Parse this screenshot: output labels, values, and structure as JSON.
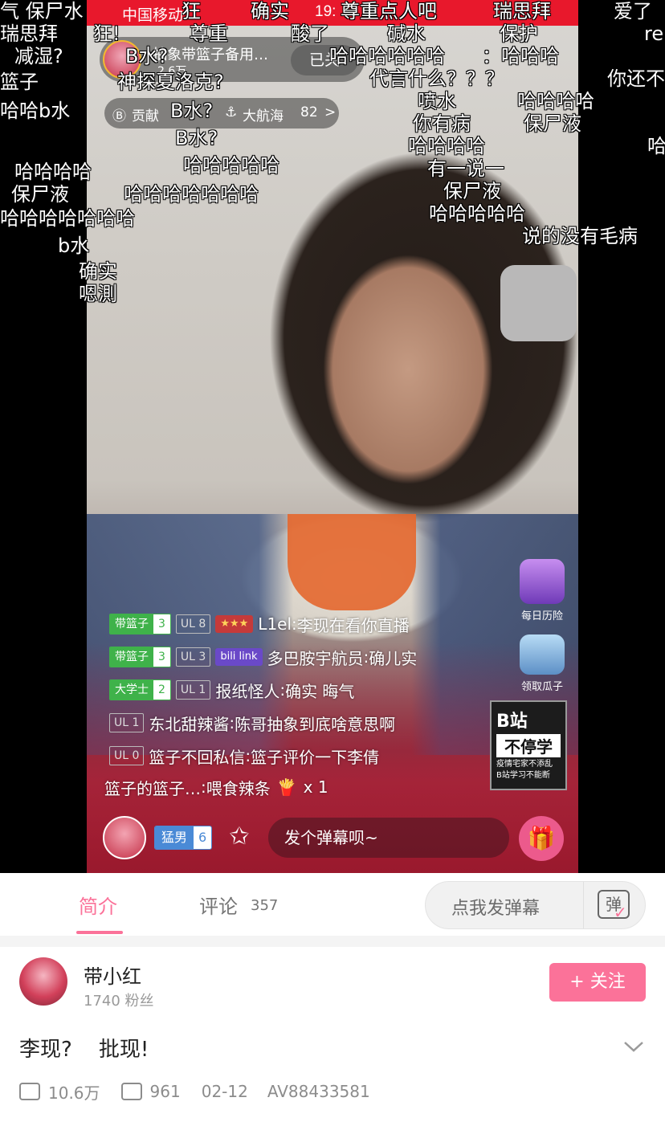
{
  "status_bar": {
    "carrier": "中国移动",
    "time": "19:"
  },
  "anchor": {
    "name": "抽象带篮子备用…",
    "popularity": "2.6万",
    "follow_label": "已关"
  },
  "rank_bar": {
    "contrib_label": "贡献",
    "fleet_label": "大航海",
    "fleet_count": "82",
    "chevron": ">"
  },
  "side": {
    "daily_adventure": "每日历险",
    "melon_seeds": "领取瓜子",
    "promo_line1": "B站",
    "promo_line2": "不停学",
    "promo_line3": "疫情宅家不添乱",
    "promo_line4": "B站学习不能断"
  },
  "chat": [
    {
      "medal_name": "带篮子",
      "medal_level": "3",
      "ul": "UL 8",
      "user": "L1el",
      "text": "李现在看你直播"
    },
    {
      "medal_name": "带篮子",
      "medal_level": "3",
      "ul": "UL 3",
      "user": "多巴胺宇航员",
      "text": "确儿实"
    },
    {
      "medal_name": "大学士",
      "medal_level": "2",
      "ul": "UL 1",
      "user": "报纸怪人",
      "text": "确实 晦气"
    },
    {
      "ul": "UL 1",
      "user": "东北甜辣酱",
      "text": "陈哥抽象到底啥意思啊"
    },
    {
      "ul": "UL 0",
      "user": "篮子不回私信",
      "text": "篮子评价一下李倩"
    },
    {
      "user": "篮子的篮子…",
      "text": "喂食辣条",
      "count": "x 1"
    }
  ],
  "live_bottom": {
    "medal_name": "猛男",
    "medal_level": "6",
    "input_placeholder": "发个弹幕呗~"
  },
  "danmaku": [
    "气 保尸水",
    "狂",
    "确实",
    "尊重点人吧",
    "瑞思拜",
    "爱了",
    "瑞思拜",
    "狂!",
    "尊重",
    "酸了",
    "碱水",
    "保护",
    "re",
    "减湿?",
    "B水?",
    "哈哈哈哈哈哈",
    "：哈哈哈",
    "篮子",
    "神探夏洛克?",
    "代言什么？？？",
    "你还不",
    "哈哈b水",
    "B水?",
    "喷水",
    "哈哈哈哈",
    "你有病",
    "保尸液",
    "B水?",
    "哈哈哈哈",
    "哈",
    "哈哈哈哈",
    "哈哈哈哈哈",
    "有一说一",
    "保尸液",
    "哈哈哈哈哈哈哈",
    "保尸液",
    "哈哈哈哈哈",
    "哈哈哈哈哈哈哈",
    "b水",
    "说的没有毛病",
    "确实",
    "嗯測"
  ],
  "tabs": {
    "intro": "简介",
    "comments": "评论",
    "comments_count": "357",
    "send_danmaku": "点我发弹幕",
    "danmaku_icon_glyph": "弹"
  },
  "uploader": {
    "name": "带小红",
    "fans": "1740 粉丝",
    "follow_label": "+ 关注"
  },
  "video": {
    "title": "李现?    批现!",
    "views": "10.6万",
    "danmaku_count": "961",
    "date": "02-12",
    "av": "AV88433581"
  },
  "colors": {
    "accent_pink": "#fb7299",
    "status_red": "#e8182c",
    "medal_green": "#3fb24a"
  }
}
